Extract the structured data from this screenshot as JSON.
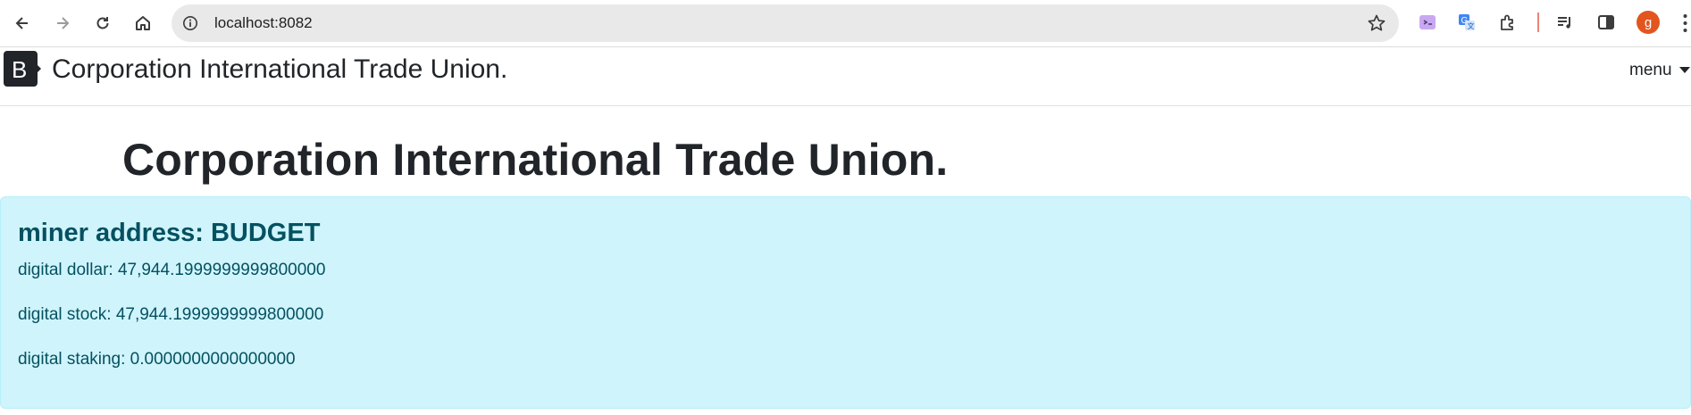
{
  "browser": {
    "url": "localhost:8082",
    "profile_initial": "g",
    "icons": [
      "back-icon",
      "forward-icon",
      "reload-icon",
      "home-icon",
      "info-icon",
      "star-icon",
      "extension-icon",
      "translate-icon",
      "puzzle-icon",
      "media-icon",
      "side-panel-icon",
      "more-icon"
    ]
  },
  "navbar": {
    "brand_letter": "B",
    "brand_text": "Corporation International Trade Union.",
    "menu_label": "menu"
  },
  "page": {
    "title": "Corporation International Trade Union."
  },
  "miner": {
    "heading": "miner address: BUDGET",
    "digital_dollar": "digital dollar: 47,944.1999999999800000",
    "digital_stock": "digital stock: 47,944.1999999999800000",
    "digital_staking": "digital staking: 0.0000000000000000"
  },
  "colors": {
    "alert_bg": "#cff4fc",
    "alert_text": "#055160",
    "brand_bg": "#212529",
    "avatar": "#e3551f"
  }
}
